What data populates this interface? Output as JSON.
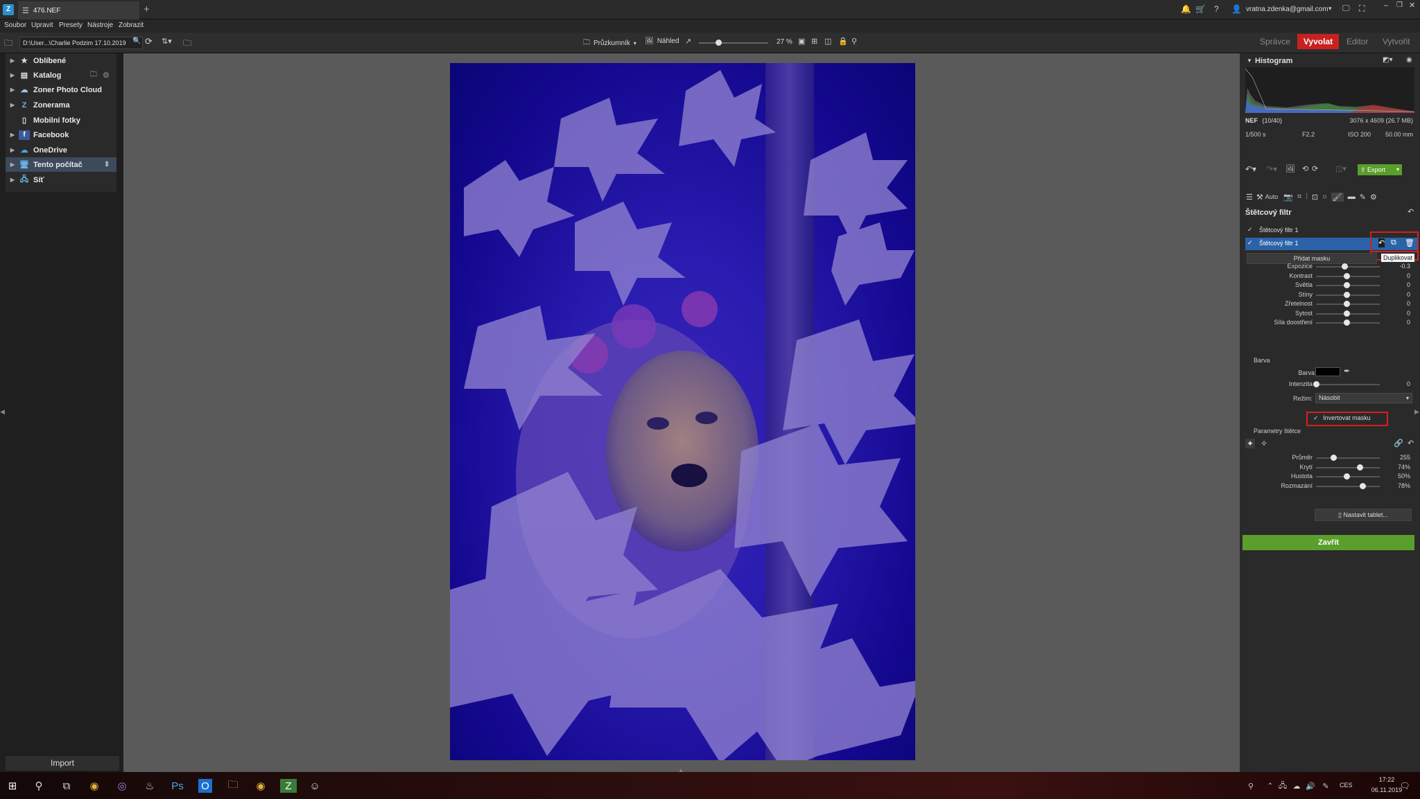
{
  "window": {
    "tab_title": "476.NEF",
    "user_email": "vratna.zdenka@gmail.com"
  },
  "menu": [
    "Soubor",
    "Upravit",
    "Presety",
    "Nástroje",
    "Zobrazit"
  ],
  "toolbar": {
    "path": "D:\\User...\\Charlie Podzim 17.10.2019",
    "explorer_label": "Průzkumník",
    "preview_label": "Náhled",
    "zoom": "27 %"
  },
  "modes": {
    "manager": "Správce",
    "develop": "Vyvolat",
    "editor": "Editor",
    "create": "Vytvořit"
  },
  "sidebar": {
    "items": [
      {
        "label": "Oblíbené",
        "icon": "star-icon"
      },
      {
        "label": "Katalog",
        "icon": "catalog-icon"
      },
      {
        "label": "Zoner Photo Cloud",
        "icon": "cloud-icon"
      },
      {
        "label": "Zonerama",
        "icon": "zonerama-icon"
      },
      {
        "label": "Mobilní fotky",
        "icon": "phone-icon"
      },
      {
        "label": "Facebook",
        "icon": "facebook-icon"
      },
      {
        "label": "OneDrive",
        "icon": "onedrive-icon"
      },
      {
        "label": "Tento počítač",
        "icon": "computer-icon"
      },
      {
        "label": "Síť",
        "icon": "network-icon"
      }
    ],
    "import_label": "Import"
  },
  "histogram": {
    "title": "Histogram",
    "format": "NEF",
    "index": "(10/40)",
    "dims": "3076 x 4609 (26.7 MB)",
    "shutter": "1/500 s",
    "aperture": "F2.2",
    "iso": "ISO 200",
    "focal": "50.00 mm"
  },
  "actions": {
    "export_label": "Export",
    "auto_label": "Auto"
  },
  "brush": {
    "title": "Štětcový filtr",
    "filters": [
      "Štětcový filtr 1",
      "Štětcový filtr 1"
    ],
    "add_mask_label": "Přidat masku",
    "tooltip": "Duplikovat",
    "sliders": [
      {
        "label": "Expozice",
        "value": "-0.3",
        "pos": 0.47
      },
      {
        "label": "Kontrast",
        "value": "0",
        "pos": 0.5
      },
      {
        "label": "Světla",
        "value": "0",
        "pos": 0.5
      },
      {
        "label": "Stíny",
        "value": "0",
        "pos": 0.5
      },
      {
        "label": "Zřetelnost",
        "value": "0",
        "pos": 0.5
      },
      {
        "label": "Sytost",
        "value": "0",
        "pos": 0.5
      },
      {
        "label": "Síla doostření",
        "value": "0",
        "pos": 0.5
      }
    ],
    "color_section": "Barva",
    "color_label": "Barva",
    "intensity_label": "Intenzita",
    "intensity_value": "0",
    "intensity_pos": 0,
    "mode_label": "Režim:",
    "mode_value": "Násobit",
    "invert_label": "Invertovat masku",
    "brush_params_label": "Parametry štětce",
    "brush_sliders": [
      {
        "label": "Průměr",
        "value": "255",
        "pos": 0.28
      },
      {
        "label": "Krytí",
        "value": "74%",
        "pos": 0.72
      },
      {
        "label": "Hustota",
        "value": "50%",
        "pos": 0.5
      },
      {
        "label": "Rozmazání",
        "value": "78%",
        "pos": 0.76
      }
    ],
    "tablet_label": "Nastavit tablet...",
    "close_label": "Zavřít"
  },
  "taskbar": {
    "time": "17:22",
    "date": "06.11.2019",
    "lang": "CES"
  },
  "colors": {
    "accent_red": "#c8211f",
    "green": "#5a9e2c",
    "selection": "#2a63a8"
  }
}
